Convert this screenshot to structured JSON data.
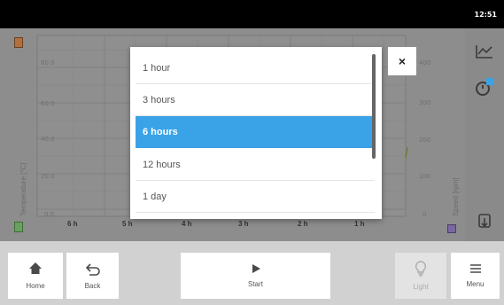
{
  "status": {
    "time": "12:51"
  },
  "chart": {
    "y_left_ticks": [
      "80.0",
      "60.0",
      "40.0",
      "20.0",
      "0.0"
    ],
    "y_right_ticks": [
      "400",
      "300",
      "200",
      "100",
      "0"
    ],
    "x_ticks": [
      "6 h",
      "5 h",
      "4 h",
      "3 h",
      "2 h",
      "1 h"
    ],
    "y_left_title": "Temperature [°C]",
    "y_right_title": "Speed [rpm]"
  },
  "rail": {
    "chart_icon": "line-chart-icon",
    "timer_icon": "timer-icon",
    "export_icon": "export-icon"
  },
  "modal": {
    "options": [
      "1 hour",
      "3 hours",
      "6 hours",
      "12 hours",
      "1 day"
    ],
    "selected_index": 2,
    "close_glyph": "×"
  },
  "toolbar": {
    "home": "Home",
    "back": "Back",
    "start": "Start",
    "light": "Light",
    "menu": "Menu"
  },
  "colors": {
    "accent": "#3aa3e8",
    "toolbar_bg": "#d1d1d1"
  }
}
